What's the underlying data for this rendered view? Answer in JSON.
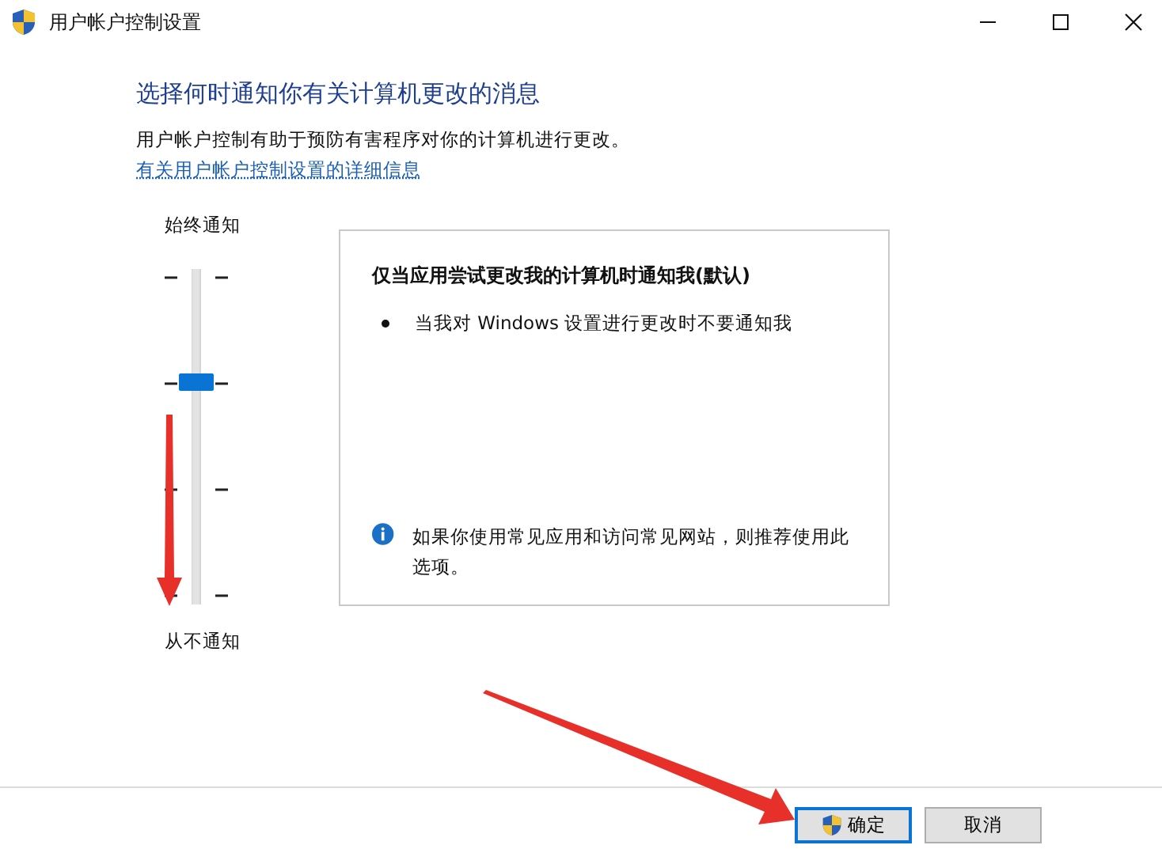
{
  "window": {
    "title": "用户帐户控制设置"
  },
  "heading": "选择何时通知你有关计算机更改的消息",
  "description": "用户帐户控制有助于预防有害程序对你的计算机进行更改。",
  "link": "有关用户帐户控制设置的详细信息",
  "slider": {
    "top_label": "始终通知",
    "bottom_label": "从不通知",
    "level": 0.667
  },
  "detail": {
    "title": "仅当应用尝试更改我的计算机时通知我(默认)",
    "bullets": [
      "当我对 Windows 设置进行更改时不要通知我"
    ],
    "info": "如果你使用常见应用和访问常见网站，则推荐使用此选项。"
  },
  "buttons": [
    {
      "label": "确定",
      "kind": "primary"
    },
    {
      "label": "取消",
      "kind": "secondary"
    }
  ]
}
